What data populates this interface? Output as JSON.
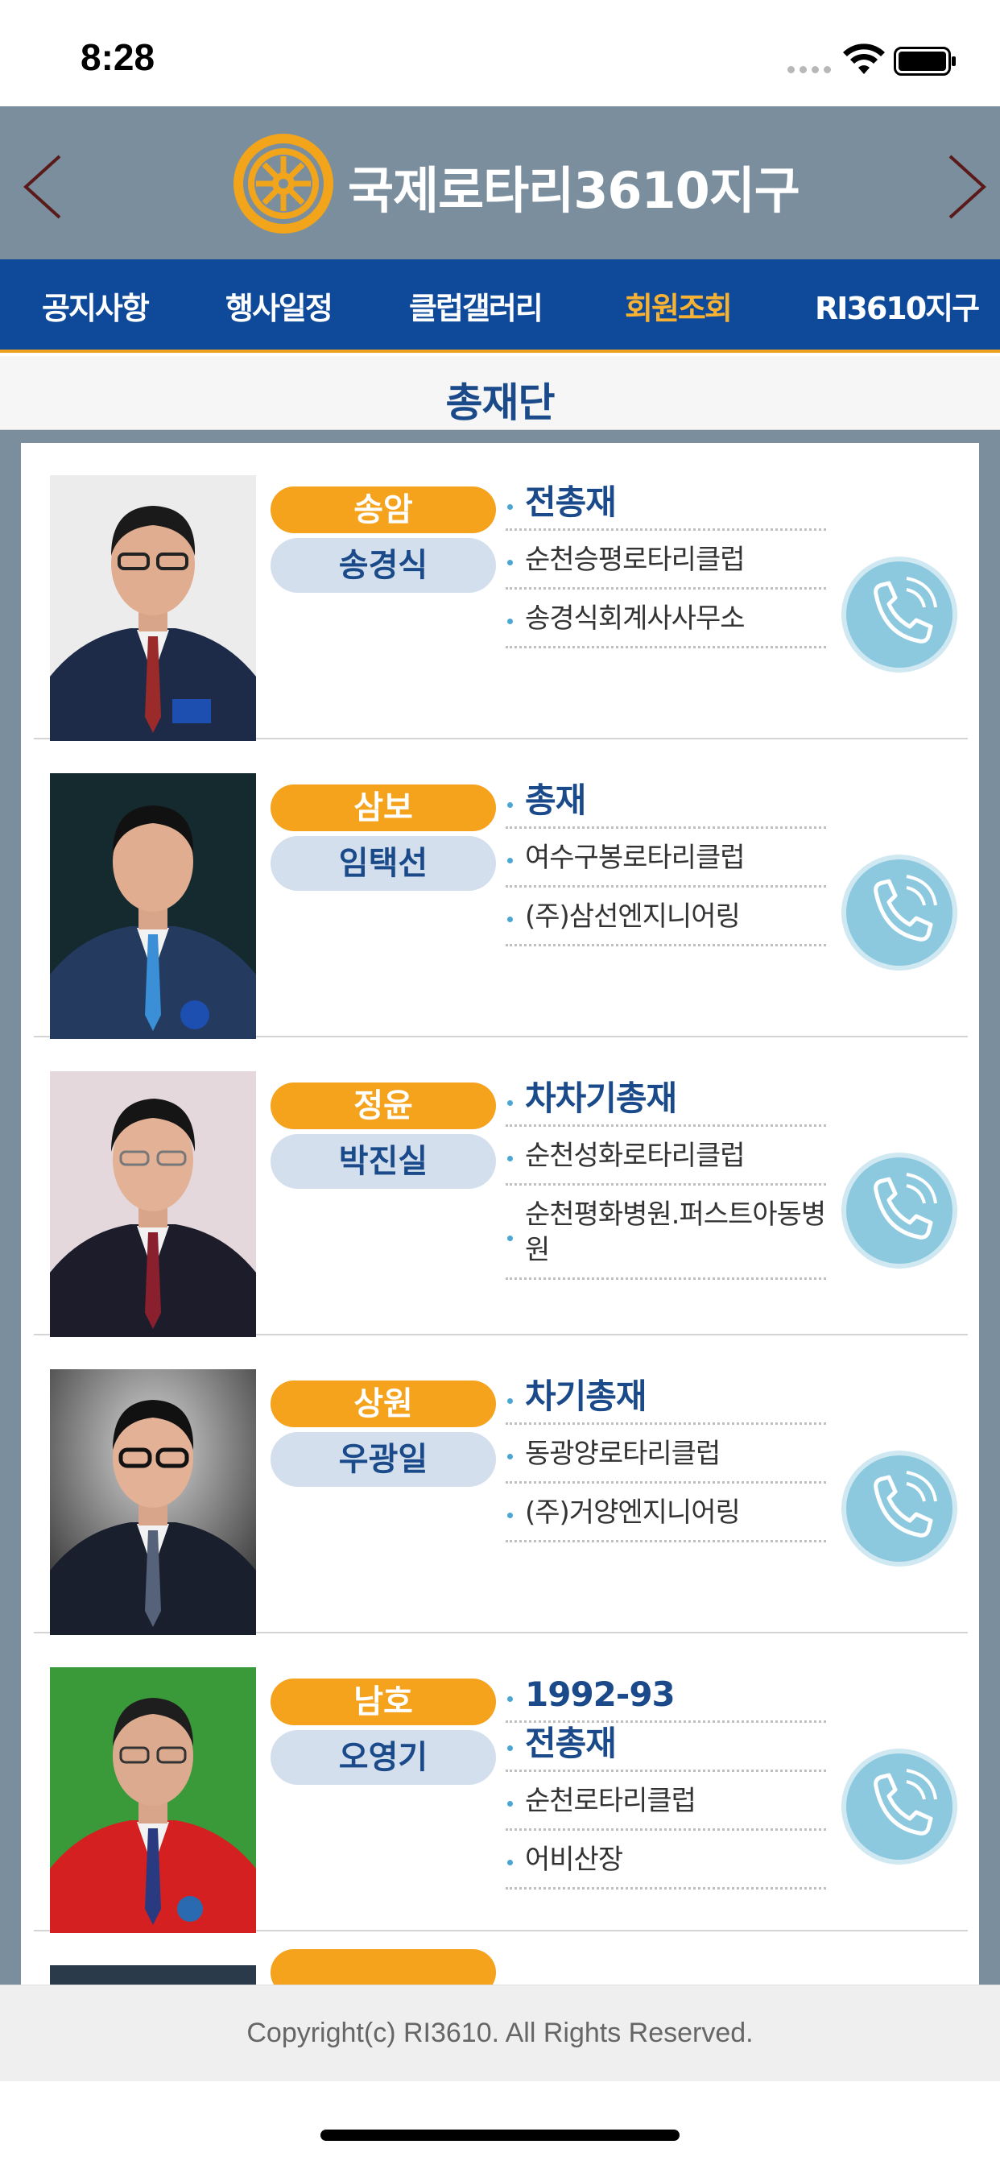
{
  "status_bar": {
    "time": "8:28"
  },
  "header": {
    "title": "국제로타리3610지구",
    "logo": "rotary-wheel-logo",
    "prev_icon": "chevron-left-icon",
    "next_icon": "chevron-right-icon"
  },
  "menu": {
    "items": [
      {
        "label": "공지사항"
      },
      {
        "label": "행사일정"
      },
      {
        "label": "클럽갤러리"
      },
      {
        "label": "회원조회",
        "active": true
      },
      {
        "label": "RI3610지구"
      }
    ],
    "active_color": "#f7b233"
  },
  "section": {
    "title": "총재단"
  },
  "members": [
    {
      "ho": "송암",
      "name": "송경식",
      "lines": [
        "전총재",
        "순천승평로타리클럽",
        "송경식회계사사무소"
      ]
    },
    {
      "ho": "삼보",
      "name": "임택선",
      "lines": [
        "총재",
        "여수구봉로타리클럽",
        "(주)삼선엔지니어링"
      ]
    },
    {
      "ho": "정윤",
      "name": "박진실",
      "lines": [
        "차차기총재",
        "순천성화로타리클럽",
        "순천평화병원.퍼스트아동병원"
      ]
    },
    {
      "ho": "상원",
      "name": "우광일",
      "lines": [
        "차기총재",
        "동광양로타리클럽",
        "(주)거양엔지니어링"
      ]
    },
    {
      "ho": "남호",
      "name": "오영기",
      "lines": [
        "1992-93",
        "전총재",
        "순천로타리클럽",
        "어비산장"
      ]
    }
  ],
  "footer": {
    "copyright": "Copyright(c) RI3610. All Rights Reserved."
  },
  "colors": {
    "header_bg": "#7b8e9e",
    "menu_bg": "#0f4a9a",
    "accent_orange": "#f5a21c",
    "name_pill": "#d3dfec",
    "title_blue": "#1a4a8a"
  }
}
